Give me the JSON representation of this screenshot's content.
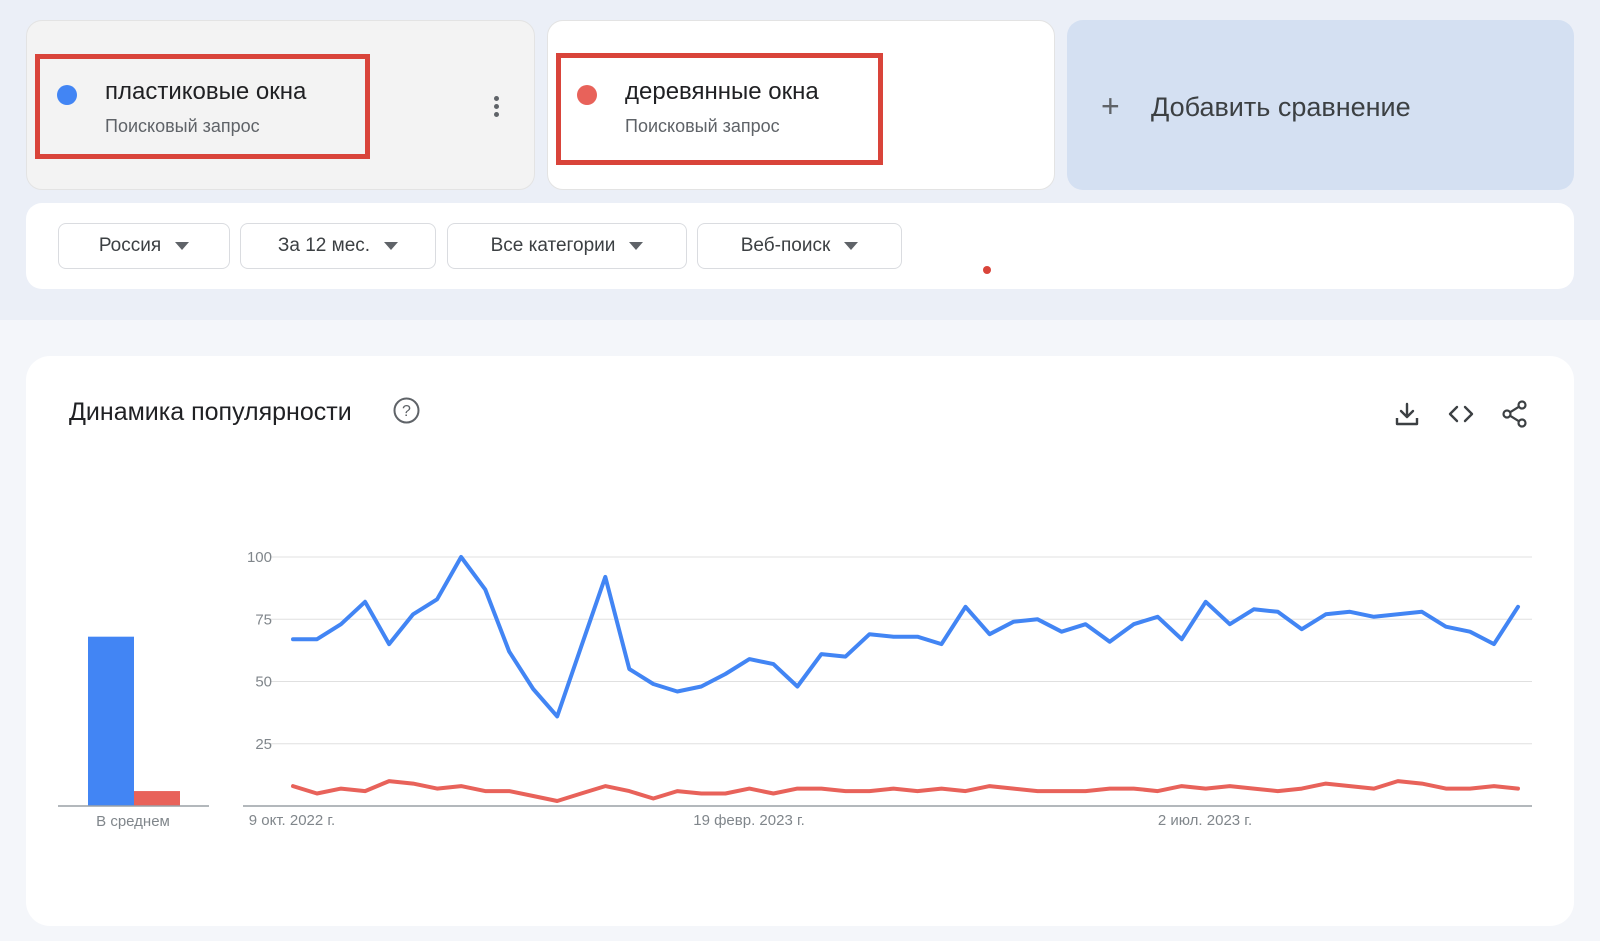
{
  "terms": [
    {
      "name": "пластиковые окна",
      "type": "Поисковый запрос",
      "color": "#4285f4"
    },
    {
      "name": "деревянные окна",
      "type": "Поисковый запрос",
      "color": "#e8625a"
    }
  ],
  "add_comparison": {
    "label": "Добавить сравнение",
    "icon": "plus-icon"
  },
  "filters": [
    {
      "label": "Россия"
    },
    {
      "label": "За 12 мес."
    },
    {
      "label": "Все категории"
    },
    {
      "label": "Веб-поиск"
    }
  ],
  "chart_section": {
    "title": "Динамика популярности",
    "icons": [
      "help-icon",
      "download-icon",
      "embed-icon",
      "share-icon"
    ]
  },
  "chart_data": {
    "type": "line",
    "y_ticks": [
      "100",
      "75",
      "50",
      "25"
    ],
    "ylim": [
      0,
      100
    ],
    "grid": true,
    "x_tick_labels": [
      "9 окт. 2022 г.",
      "19 февр. 2023 г.",
      "2 июл. 2023 г."
    ],
    "average": {
      "label": "В среднем",
      "values": [
        68,
        6
      ]
    },
    "series": [
      {
        "color": "#4285f4",
        "values": [
          67,
          67,
          73,
          82,
          65,
          77,
          83,
          100,
          87,
          62,
          47,
          36,
          64,
          92,
          55,
          49,
          46,
          48,
          53,
          59,
          57,
          48,
          61,
          60,
          69,
          68,
          68,
          65,
          80,
          69,
          74,
          75,
          70,
          73,
          66,
          73,
          76,
          67,
          82,
          73,
          79,
          78,
          71,
          77,
          78,
          76,
          77,
          78,
          72,
          70,
          65,
          80
        ]
      },
      {
        "color": "#e8625a",
        "values": [
          8,
          5,
          7,
          6,
          10,
          9,
          7,
          8,
          6,
          6,
          4,
          2,
          5,
          8,
          6,
          3,
          6,
          5,
          5,
          7,
          5,
          7,
          7,
          6,
          6,
          7,
          6,
          7,
          6,
          8,
          7,
          6,
          6,
          6,
          7,
          7,
          6,
          8,
          7,
          8,
          7,
          6,
          7,
          9,
          8,
          7,
          10,
          9,
          7,
          7,
          8,
          7
        ]
      }
    ]
  }
}
